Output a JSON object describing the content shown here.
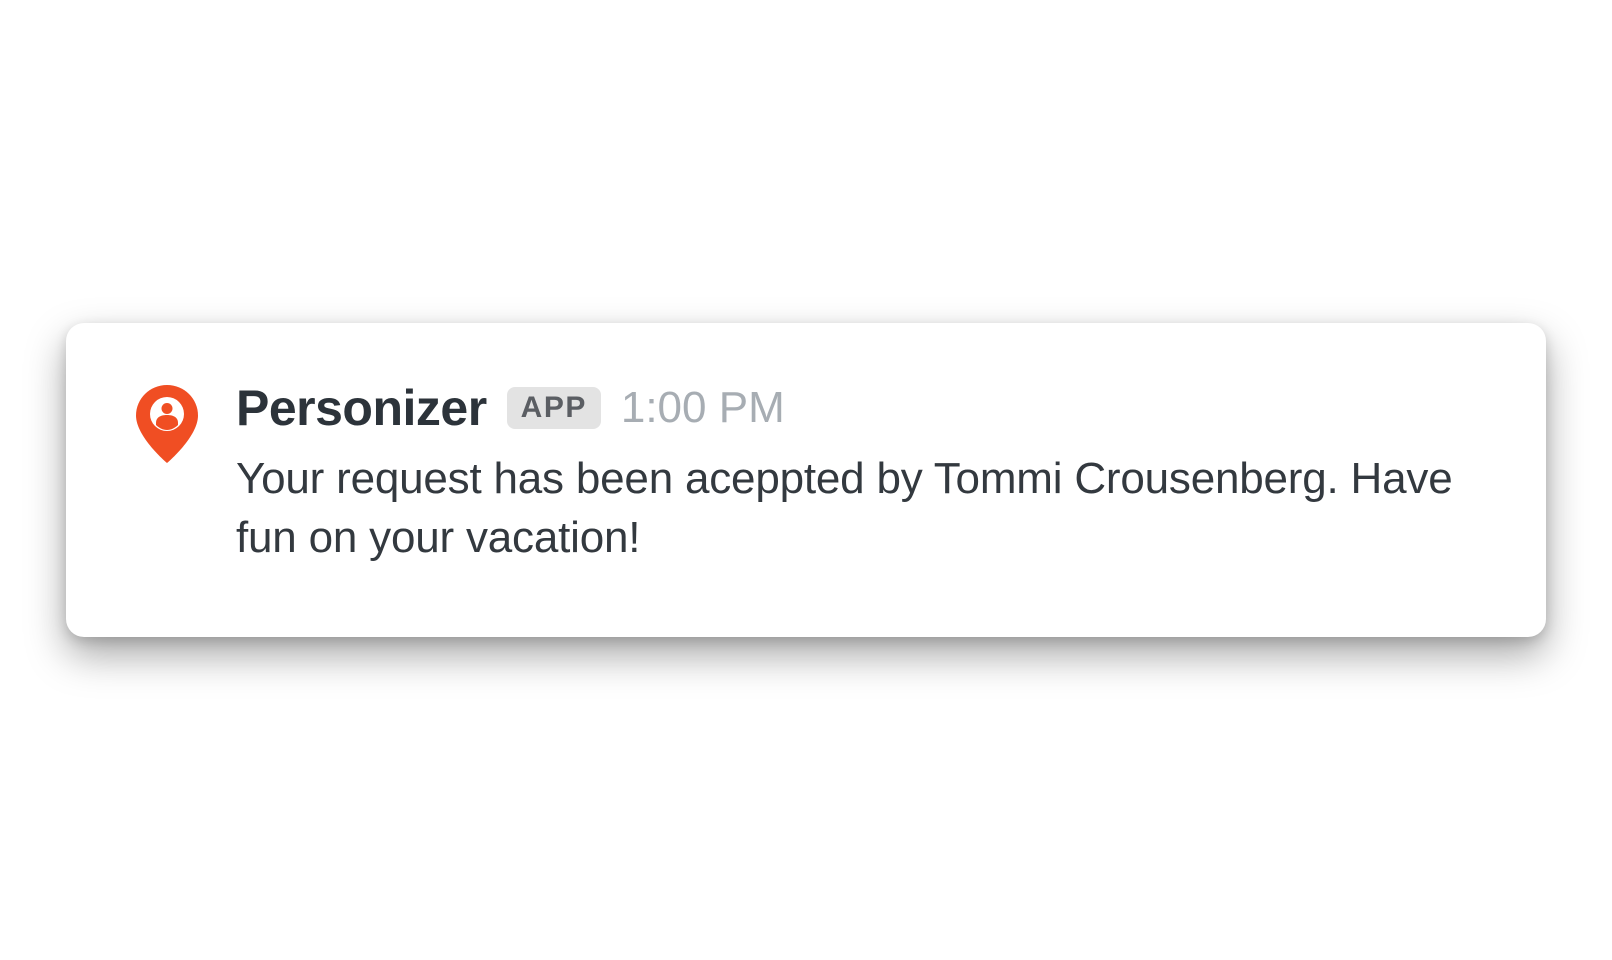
{
  "notification": {
    "app_name": "Personizer",
    "badge_label": "APP",
    "timestamp": "1:00 PM",
    "message": "Your request has been aceppted by Tommi Crousenberg. Have fun on your vacation!",
    "icon": "person-pin-icon",
    "colors": {
      "accent": "#f04e23",
      "card_bg": "#ffffff",
      "text_primary": "#2c333a",
      "text_body": "#33393f",
      "text_muted": "#a7adb3",
      "badge_bg": "#e3e3e3",
      "badge_text": "#5b5e63"
    }
  }
}
